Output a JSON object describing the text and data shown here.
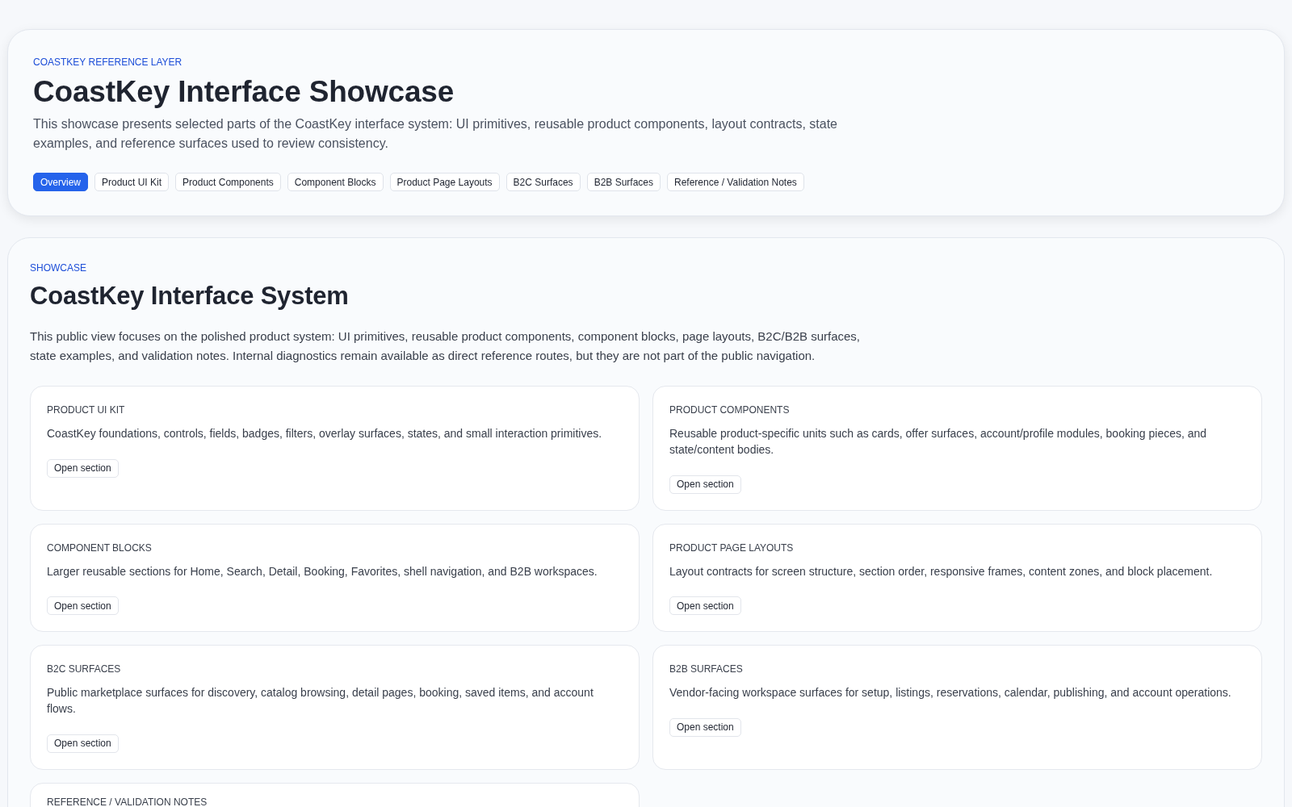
{
  "header": {
    "eyebrow": "COASTKEY REFERENCE LAYER",
    "title": "CoastKey Interface Showcase",
    "description": "This showcase presents selected parts of the CoastKey interface system: UI primitives, reusable product components, layout contracts, state examples, and reference surfaces used to review consistency.",
    "tabs": [
      {
        "label": "Overview",
        "selected": true
      },
      {
        "label": "Product UI Kit",
        "selected": false
      },
      {
        "label": "Product Components",
        "selected": false
      },
      {
        "label": "Component Blocks",
        "selected": false
      },
      {
        "label": "Product Page Layouts",
        "selected": false
      },
      {
        "label": "B2C Surfaces",
        "selected": false
      },
      {
        "label": "B2B Surfaces",
        "selected": false
      },
      {
        "label": "Reference / Validation Notes",
        "selected": false
      }
    ]
  },
  "showcase": {
    "eyebrow": "SHOWCASE",
    "title": "CoastKey Interface System",
    "description": "This public view focuses on the polished product system: UI primitives, reusable product components, component blocks, page layouts, B2C/B2B surfaces, state examples, and validation notes. Internal diagnostics remain available as direct reference routes, but they are not part of the public navigation.",
    "cards": [
      {
        "title": "PRODUCT UI KIT",
        "description": "CoastKey foundations, controls, fields, badges, filters, overlay surfaces, states, and small interaction primitives.",
        "button": "Open section"
      },
      {
        "title": "PRODUCT COMPONENTS",
        "description": "Reusable product-specific units such as cards, offer surfaces, account/profile modules, booking pieces, and state/content bodies.",
        "button": "Open section"
      },
      {
        "title": "COMPONENT BLOCKS",
        "description": "Larger reusable sections for Home, Search, Detail, Booking, Favorites, shell navigation, and B2B workspaces.",
        "button": "Open section"
      },
      {
        "title": "PRODUCT PAGE LAYOUTS",
        "description": "Layout contracts for screen structure, section order, responsive frames, content zones, and block placement.",
        "button": "Open section"
      },
      {
        "title": "B2C SURFACES",
        "description": "Public marketplace surfaces for discovery, catalog browsing, detail pages, booking, saved items, and account flows.",
        "button": "Open section"
      },
      {
        "title": "B2B SURFACES",
        "description": "Vendor-facing workspace surfaces for setup, listings, reservations, calendar, publishing, and account operations.",
        "button": "Open section"
      },
      {
        "title": "REFERENCE / VALIDATION NOTES"
      }
    ]
  }
}
